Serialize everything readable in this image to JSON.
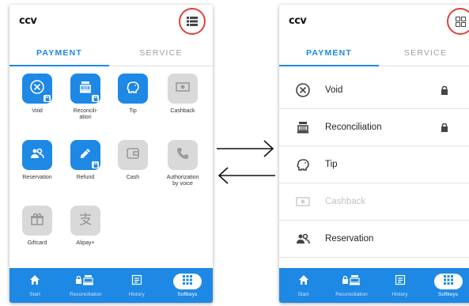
{
  "left": {
    "logo": "ccv",
    "tabs": {
      "payment": "PAYMENT",
      "service": "SERVICE"
    },
    "tiles": [
      {
        "label": "Void",
        "icon": "void-icon",
        "enabled": true,
        "locked": true
      },
      {
        "label": "Reconcili-\nation",
        "icon": "register-icon",
        "enabled": true,
        "locked": true
      },
      {
        "label": "Tip",
        "icon": "piggy-bank-icon",
        "enabled": true,
        "locked": false
      },
      {
        "label": "Cashback",
        "icon": "cash-icon",
        "enabled": false,
        "locked": false
      },
      {
        "label": "Reservation",
        "icon": "reservation-icon",
        "enabled": true,
        "locked": false
      },
      {
        "label": "Refund",
        "icon": "refund-icon",
        "enabled": true,
        "locked": true
      },
      {
        "label": "Cash",
        "icon": "wallet-icon",
        "enabled": false,
        "locked": false
      },
      {
        "label": "Authorization\nby voice",
        "icon": "phone-icon",
        "enabled": false,
        "locked": false
      },
      {
        "label": "Giftcard",
        "icon": "gift-icon",
        "enabled": false,
        "locked": false
      },
      {
        "label": "Alipay+",
        "icon": "alipay-icon",
        "enabled": false,
        "locked": false
      }
    ]
  },
  "right": {
    "logo": "ccv",
    "tabs": {
      "payment": "PAYMENT",
      "service": "SERVICE"
    },
    "rows": [
      {
        "label": "Void",
        "icon": "void-icon",
        "enabled": true,
        "locked": true
      },
      {
        "label": "Reconciliation",
        "icon": "register-icon",
        "enabled": true,
        "locked": true
      },
      {
        "label": "Tip",
        "icon": "piggy-bank-icon",
        "enabled": true,
        "locked": false
      },
      {
        "label": "Cashback",
        "icon": "cash-icon",
        "enabled": false,
        "locked": false
      },
      {
        "label": "Reservation",
        "icon": "reservation-icon",
        "enabled": true,
        "locked": false
      }
    ]
  },
  "nav": [
    {
      "label": "Start",
      "icon": "home-icon"
    },
    {
      "label": "Reconciliation",
      "icon": "lock-register-icon"
    },
    {
      "label": "History",
      "icon": "history-icon"
    },
    {
      "label": "Softkeys",
      "icon": "softkeys-grid-icon",
      "selected": true
    }
  ],
  "colors": {
    "primary": "#1e88e5",
    "highlight": "#e0413a",
    "disabled": "#d9d9d9"
  }
}
